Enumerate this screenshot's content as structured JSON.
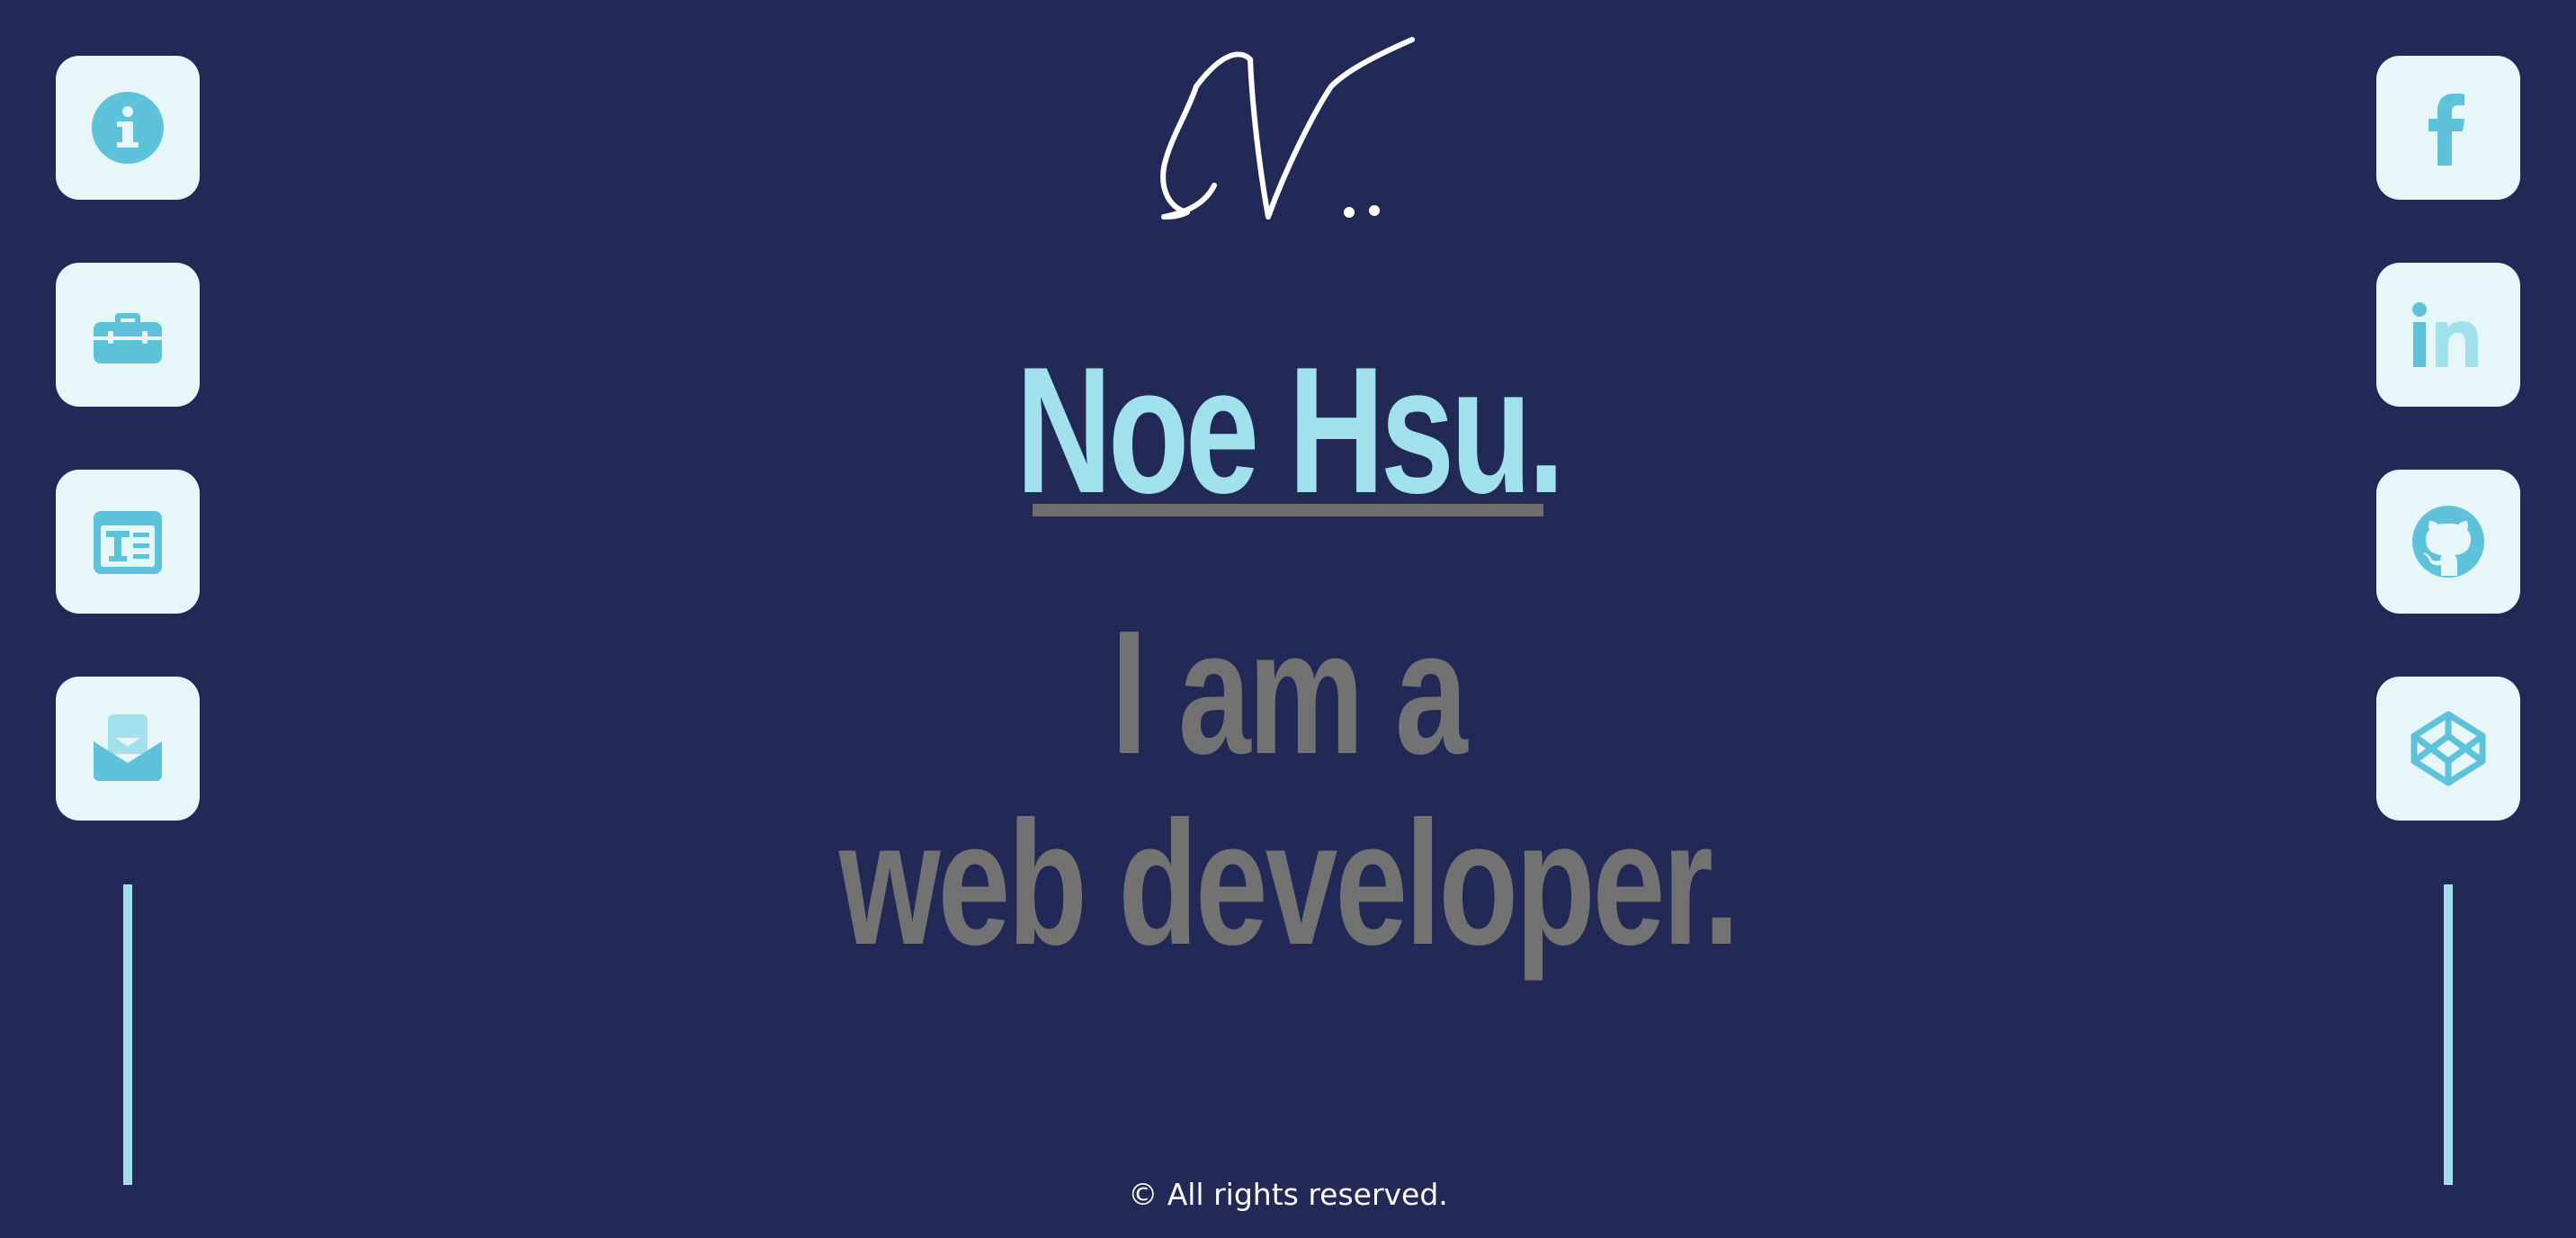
{
  "nav_left": [
    {
      "icon": "info-icon"
    },
    {
      "icon": "briefcase-icon"
    },
    {
      "icon": "article-icon"
    },
    {
      "icon": "mail-open-icon"
    }
  ],
  "nav_right": [
    {
      "icon": "facebook-icon"
    },
    {
      "icon": "linkedin-icon"
    },
    {
      "icon": "github-icon"
    },
    {
      "icon": "codepen-icon"
    }
  ],
  "logo": {
    "icon": "signature-logo"
  },
  "hero": {
    "name": "Noe Hsu.",
    "tagline_line1": "I am a",
    "tagline_line2": "web developer."
  },
  "footer": {
    "text": "© All rights reserved."
  },
  "colors": {
    "background": "#232957",
    "tile_bg": "#e6f6f9",
    "icon": "#5ec3da",
    "name": "#a0e1ec",
    "tagline": "#727272",
    "line": "#9fdde9"
  }
}
